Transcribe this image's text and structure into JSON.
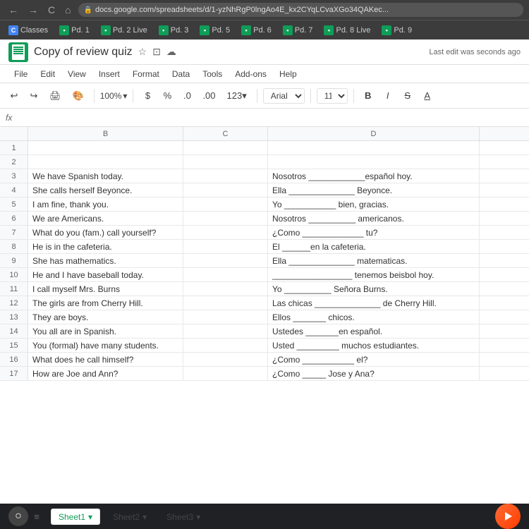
{
  "browser": {
    "back_btn": "←",
    "forward_btn": "→",
    "refresh_btn": "C",
    "home_btn": "⌂",
    "url": "docs.google.com/spreadsheets/d/1-yzNhRgP0lngAo4E_kx2CYqLCvaXGo34QAKec...",
    "lock_icon": "🔒"
  },
  "bookmarks": [
    {
      "label": "Classes",
      "color": "#4285f4",
      "short": "C"
    },
    {
      "label": "Pd. 1",
      "color": "#0f9d58",
      "short": "▪"
    },
    {
      "label": "Pd. 2 Live",
      "color": "#0f9d58",
      "short": "▪"
    },
    {
      "label": "Pd. 3",
      "color": "#0f9d58",
      "short": "▪"
    },
    {
      "label": "Pd. 5",
      "color": "#0f9d58",
      "short": "▪"
    },
    {
      "label": "Pd. 6",
      "color": "#0f9d58",
      "short": "▪"
    },
    {
      "label": "Pd. 7",
      "color": "#0f9d58",
      "short": "▪"
    },
    {
      "label": "Pd. 8 Live",
      "color": "#0f9d58",
      "short": "▪"
    },
    {
      "label": "Pd. 9",
      "color": "#0f9d58",
      "short": "▪"
    }
  ],
  "title": "Copy of review quiz",
  "last_edit": "Last edit was seconds ago",
  "menu": [
    "File",
    "Edit",
    "View",
    "Insert",
    "Format",
    "Data",
    "Tools",
    "Add-ons",
    "Help"
  ],
  "toolbar": {
    "undo": "↩",
    "redo": "↪",
    "print": "🖨",
    "paint": "🎨",
    "zoom": "100%",
    "currency": "$",
    "percent": "%",
    "decimal0": ".0",
    "decimal00": ".00",
    "format123": "123▾",
    "font": "Arial",
    "font_size": "11",
    "bold": "B",
    "italic": "I",
    "strikethrough": "S",
    "underline": "A"
  },
  "formula_bar": {
    "cell_ref": "fx",
    "formula": ""
  },
  "columns": {
    "headers": [
      "",
      "B",
      "C",
      "D"
    ],
    "widths": [
      40,
      220,
      120,
      300
    ]
  },
  "rows": [
    {
      "num": "1",
      "b": "",
      "c": "",
      "d": ""
    },
    {
      "num": "2",
      "b": "",
      "c": "",
      "d": ""
    },
    {
      "num": "3",
      "b": "We have Spanish today.",
      "c": "",
      "d": "Nosotros ____________español hoy."
    },
    {
      "num": "4",
      "b": "She calls herself Beyonce.",
      "c": "",
      "d": "Ella ______________ Beyonce."
    },
    {
      "num": "5",
      "b": "I am fine, thank you.",
      "c": "",
      "d": "Yo ___________ bien, gracias."
    },
    {
      "num": "6",
      "b": "We are Americans.",
      "c": "",
      "d": "Nosotros __________ americanos."
    },
    {
      "num": "7",
      "b": "What do you (fam.) call yourself?",
      "c": "",
      "d": "¿Como _____________ tu?"
    },
    {
      "num": "8",
      "b": "He is in the cafeteria.",
      "c": "",
      "d": "El ______en la cafeteria."
    },
    {
      "num": "9",
      "b": "She has mathematics.",
      "c": "",
      "d": "Ella ______________ matematicas."
    },
    {
      "num": "10",
      "b": "He and I have baseball today.",
      "c": "",
      "d": "_________________ tenemos beisbol hoy."
    },
    {
      "num": "11",
      "b": "I call myself Mrs. Burns",
      "c": "",
      "d": "Yo __________ Señora Burns."
    },
    {
      "num": "12",
      "b": "The girls are from Cherry Hill.",
      "c": "",
      "d": "Las chicas ______________ de Cherry Hill."
    },
    {
      "num": "13",
      "b": "They are boys.",
      "c": "",
      "d": "Ellos _______ chicos."
    },
    {
      "num": "14",
      "b": "You all are in Spanish.",
      "c": "",
      "d": "Ustedes _______en español."
    },
    {
      "num": "15",
      "b": "You (formal) have many students.",
      "c": "",
      "d": "Usted _________ muchos estudiantes."
    },
    {
      "num": "16",
      "b": "What does he call himself?",
      "c": "",
      "d": "¿Como ___________ el?"
    },
    {
      "num": "17",
      "b": "How are Joe and Ann?",
      "c": "",
      "d": "¿Como _____ Jose y Ana?"
    }
  ],
  "sheets": [
    {
      "label": "Sheet1",
      "active": true
    },
    {
      "label": "Sheet2",
      "active": false
    },
    {
      "label": "Sheet3",
      "active": false
    }
  ]
}
